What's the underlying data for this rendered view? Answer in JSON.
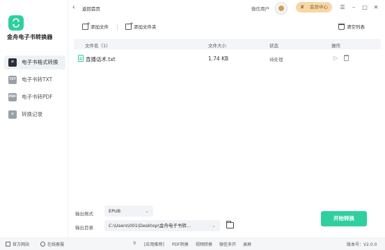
{
  "app": {
    "name": "金舟电子书转换器"
  },
  "sidebar": {
    "items": [
      {
        "label": "电子书格式转换",
        "icon": "exchange-icon",
        "icon_text": "",
        "active": true
      },
      {
        "label": "电子书转TXT",
        "icon": "txt-icon",
        "icon_text": "TXT",
        "active": false
      },
      {
        "label": "电子书转PDF",
        "icon": "pdf-icon",
        "icon_text": "PDF",
        "active": false
      },
      {
        "label": "转换记录",
        "icon": "history-icon",
        "icon_text": "",
        "active": false
      }
    ]
  },
  "header": {
    "back_label": "返回首页",
    "user_name": "微信用户",
    "vip_label": "会员中心",
    "window_controls": [
      "menu-icon",
      "minimize-icon",
      "maximize-icon",
      "close-icon"
    ]
  },
  "toolbar": {
    "add_file": "添加文件",
    "add_folder": "添加文件夹",
    "clear_list": "清空列表"
  },
  "table": {
    "columns": {
      "name": "文件名（1）",
      "size": "文件大小",
      "status": "状态",
      "action": "操作"
    },
    "rows": [
      {
        "name": "直播话术.txt",
        "size": "1.74 KB",
        "status": "待处理"
      }
    ]
  },
  "settings": {
    "format_label": "输出格式",
    "format_value": "EPUB",
    "dir_label": "输出目录",
    "dir_value": "C:\\Users\\001\\Desktop\\金舟电子书转...",
    "convert_button": "开始转换"
  },
  "footer": {
    "website": "官方网站",
    "support": "在线客服",
    "recommend": "[应用推荐]",
    "links": [
      "PDF转换",
      "视频转换",
      "微信多开",
      "录屏"
    ],
    "version": "版本号：V2.0.0"
  },
  "colors": {
    "accent": "#2fcf9e",
    "vip": "#f6d7a7"
  }
}
